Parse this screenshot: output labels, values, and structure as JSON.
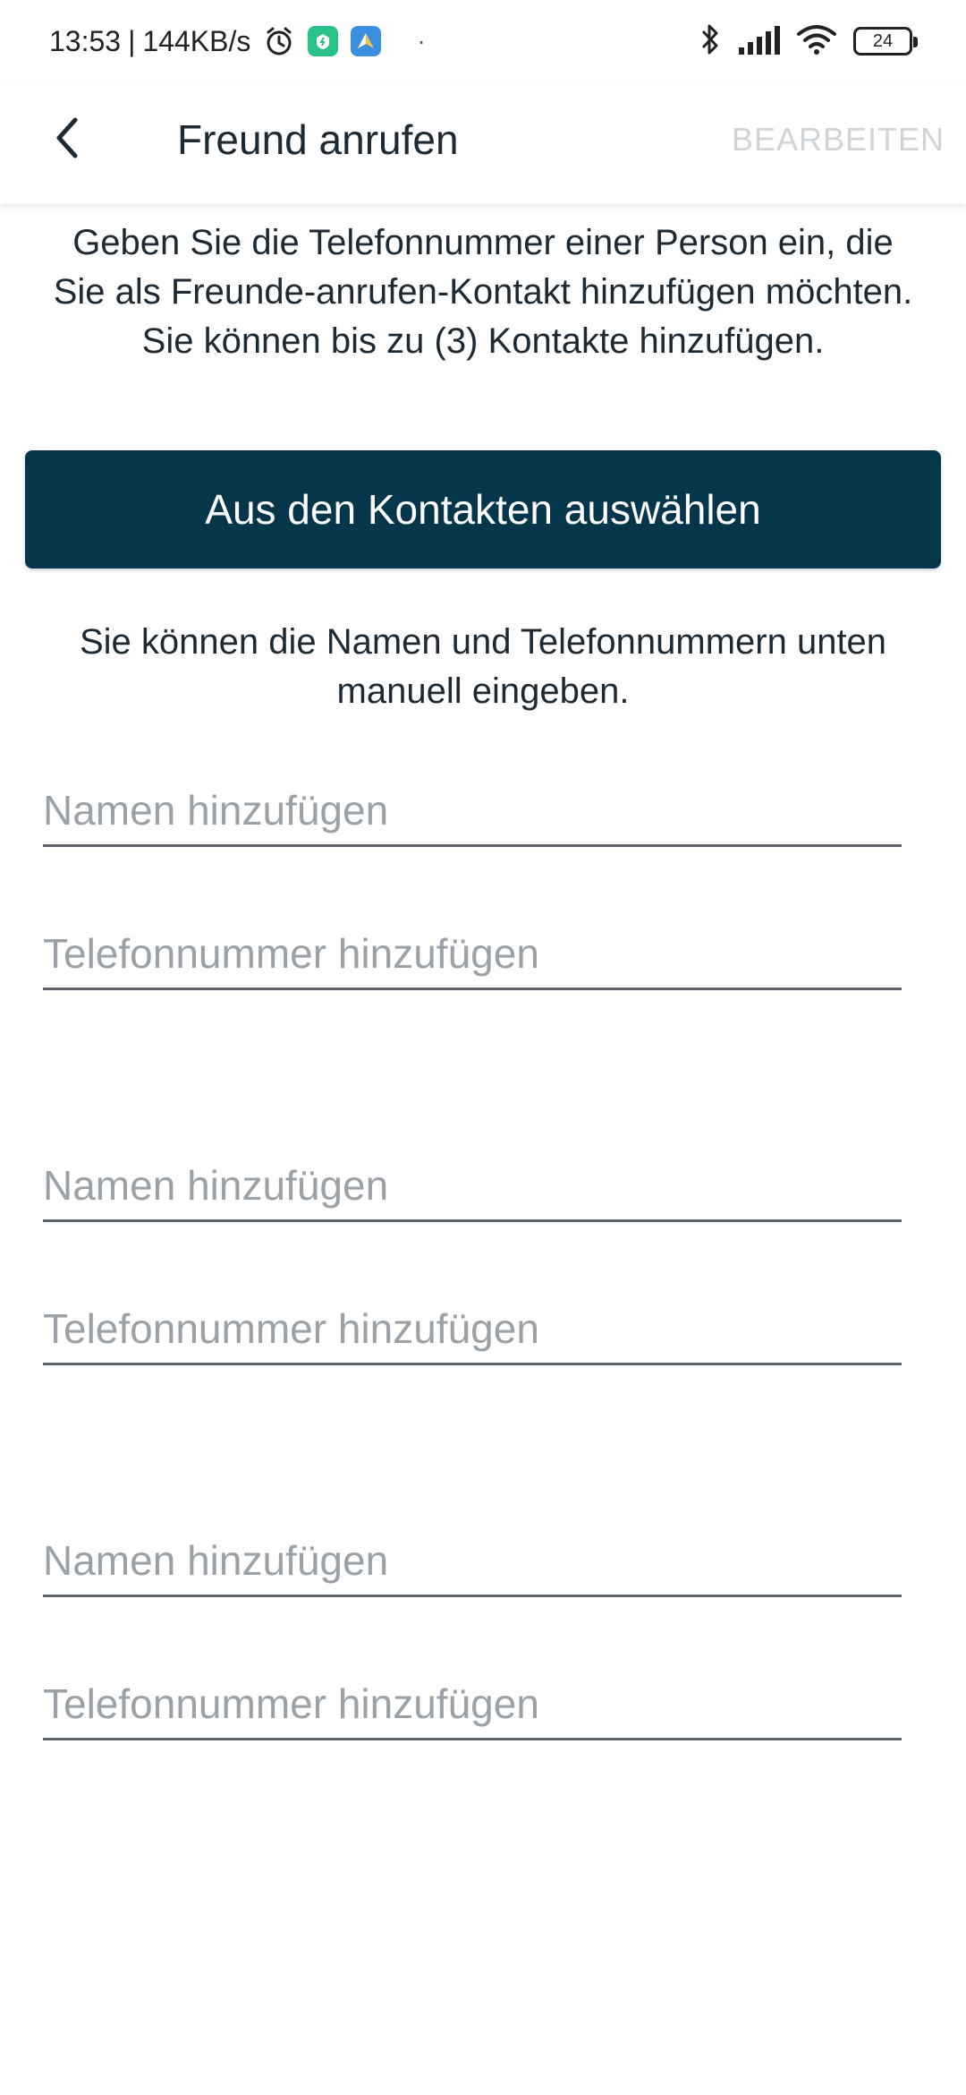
{
  "status_bar": {
    "time": "13:53",
    "separator": "|",
    "net_speed": "144KB/s",
    "dot": "·",
    "battery_level": "24",
    "icons": [
      "alarm-icon",
      "app-green-icon",
      "app-blue-icon",
      "bluetooth-icon",
      "signal-icon",
      "wifi-icon",
      "battery-icon"
    ]
  },
  "header": {
    "title": "Freund anrufen",
    "edit_label": "BEARBEITEN",
    "back_icon": "chevron-left-icon"
  },
  "intro": {
    "line1": "Geben Sie die Telefonnummer einer Person ein, die Sie als Freunde-anrufen-Kontakt hinzufügen möchten.",
    "line2": "Sie können bis zu (3) Kontakte hinzufügen."
  },
  "select_button": {
    "label": "Aus den Kontakten auswählen"
  },
  "manual_hint": "Sie können die Namen und Telefonnummern unten manuell eingeben.",
  "contacts": [
    {
      "name_placeholder": "Namen hinzufügen",
      "phone_placeholder": "Telefonnummer hinzufügen",
      "name_value": "",
      "phone_value": ""
    },
    {
      "name_placeholder": "Namen hinzufügen",
      "phone_placeholder": "Telefonnummer hinzufügen",
      "name_value": "",
      "phone_value": ""
    },
    {
      "name_placeholder": "Namen hinzufügen",
      "phone_placeholder": "Telefonnummer hinzufügen",
      "name_value": "",
      "phone_value": ""
    }
  ],
  "colors": {
    "primary_button": "#06364c",
    "edit_disabled": "#cfd4d8",
    "placeholder": "#9aa2a8",
    "underline": "#5d656b"
  }
}
